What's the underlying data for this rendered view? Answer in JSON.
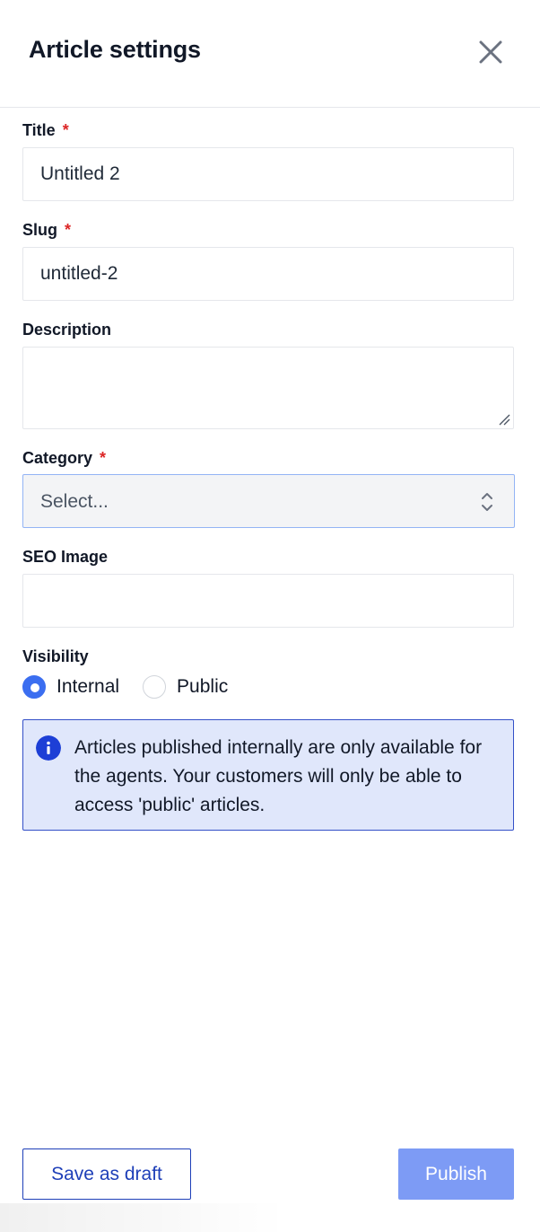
{
  "header": {
    "title": "Article settings",
    "close_icon": "close-icon"
  },
  "form": {
    "required_marker": "*",
    "title": {
      "label": "Title",
      "value": "Untitled 2",
      "required": true
    },
    "slug": {
      "label": "Slug",
      "value": "untitled-2",
      "required": true
    },
    "description": {
      "label": "Description",
      "value": "",
      "required": false
    },
    "category": {
      "label": "Category",
      "placeholder": "Select...",
      "required": true
    },
    "seo_image": {
      "label": "SEO Image",
      "value": "",
      "required": false
    },
    "visibility": {
      "label": "Visibility",
      "options": [
        {
          "label": "Internal",
          "checked": true
        },
        {
          "label": "Public",
          "checked": false
        }
      ]
    }
  },
  "info": {
    "icon": "info-icon",
    "text": "Articles published internally are only available for the agents. Your customers will only be able to access 'public' articles."
  },
  "footer": {
    "save_draft_label": "Save as draft",
    "publish_label": "Publish"
  },
  "colors": {
    "required": "#dc2626",
    "accent": "#3b6ef0",
    "info_background": "#e0e7fb",
    "info_border": "#3450c8",
    "publish_button": "#7d9bf5",
    "draft_button_border": "#1e3fb8"
  }
}
